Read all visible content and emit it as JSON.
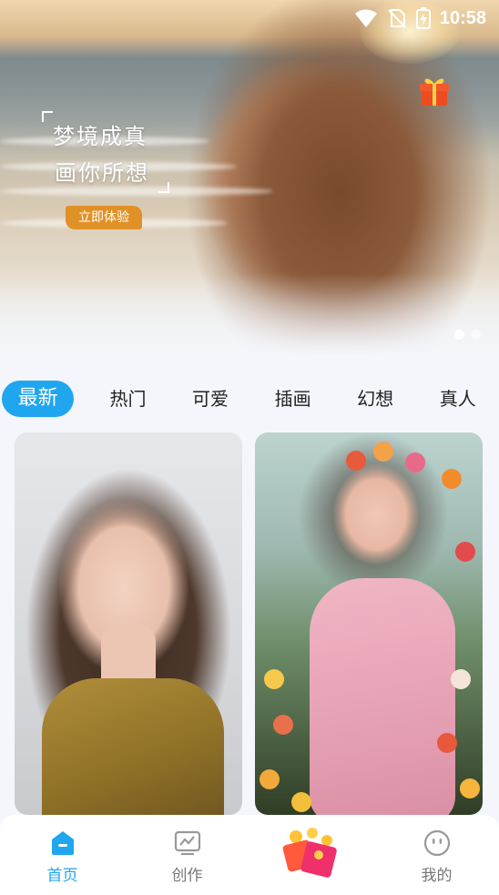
{
  "status_bar": {
    "time": "10:58"
  },
  "banner": {
    "slogan_line1": "梦境成真",
    "slogan_line2": "画你所想",
    "cta_label": "立即体验",
    "page_count": 2,
    "active_index": 0
  },
  "tabs": [
    "最新",
    "热门",
    "可爱",
    "插画",
    "幻想",
    "真人"
  ],
  "active_tab": 0,
  "nav": [
    {
      "label": "首页",
      "icon": "home-icon",
      "active": true
    },
    {
      "label": "创作",
      "icon": "create-icon",
      "active": false
    },
    {
      "label": "",
      "icon": "red-envelope-icon",
      "active": false
    },
    {
      "label": "我的",
      "icon": "profile-icon",
      "active": false
    }
  ],
  "colors": {
    "accent": "#1fa6ef",
    "cta": "#e09126"
  }
}
